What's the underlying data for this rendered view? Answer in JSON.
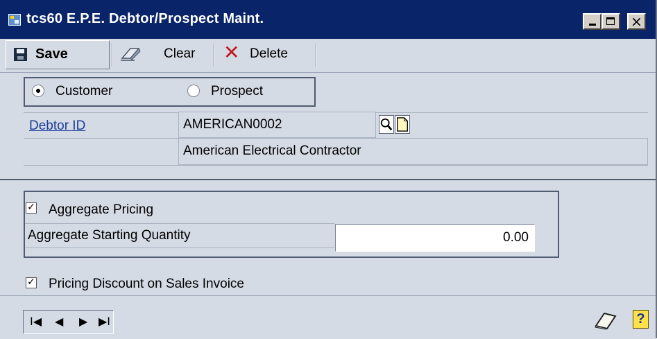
{
  "window": {
    "title": "tcs60 E.P.E.  Debtor/Prospect Maint.",
    "close_glyph": "×",
    "icons": {
      "app": "app-window-icon",
      "minimize": "minimize-icon",
      "maximize": "maximize-icon",
      "close": "close-icon"
    }
  },
  "toolbar": {
    "save_label": "Save",
    "clear_label": "Clear",
    "delete_label": "Delete",
    "delete_glyph": "✕",
    "icons": {
      "save": "floppy-disk-icon",
      "clear": "eraser-icon",
      "delete": "red-x-icon"
    }
  },
  "type_selector": {
    "options": [
      {
        "label": "Customer",
        "selected": true
      },
      {
        "label": "Prospect",
        "selected": false
      }
    ]
  },
  "debtor": {
    "id_label": "Debtor ID",
    "id_value": "AMERICAN0002",
    "name_value": "American Electrical Contractor",
    "icons": {
      "lookup": "magnifier-lookup-icon",
      "new": "new-document-icon"
    }
  },
  "aggregate": {
    "pricing_label": "Aggregate Pricing",
    "pricing_checked": true,
    "check_glyph": "✓",
    "starting_qty_label": "Aggregate Starting Quantity",
    "starting_qty_value": "0.00"
  },
  "pricing_discount": {
    "label": "Pricing Discount on Sales Invoice",
    "checked": true,
    "check_glyph": "✓"
  },
  "navigation": {
    "first": "I◀",
    "prev": "◀",
    "next": "▶",
    "last": "▶I",
    "icons": {
      "note": "note-icon",
      "help": "help-icon"
    },
    "help_glyph": "?"
  },
  "colors": {
    "titlebar": "#0a246a",
    "window_bg": "#d5dbe5",
    "link": "#1a3b9a",
    "delete_red": "#c0151d",
    "help_yellow": "#ffe24a"
  }
}
